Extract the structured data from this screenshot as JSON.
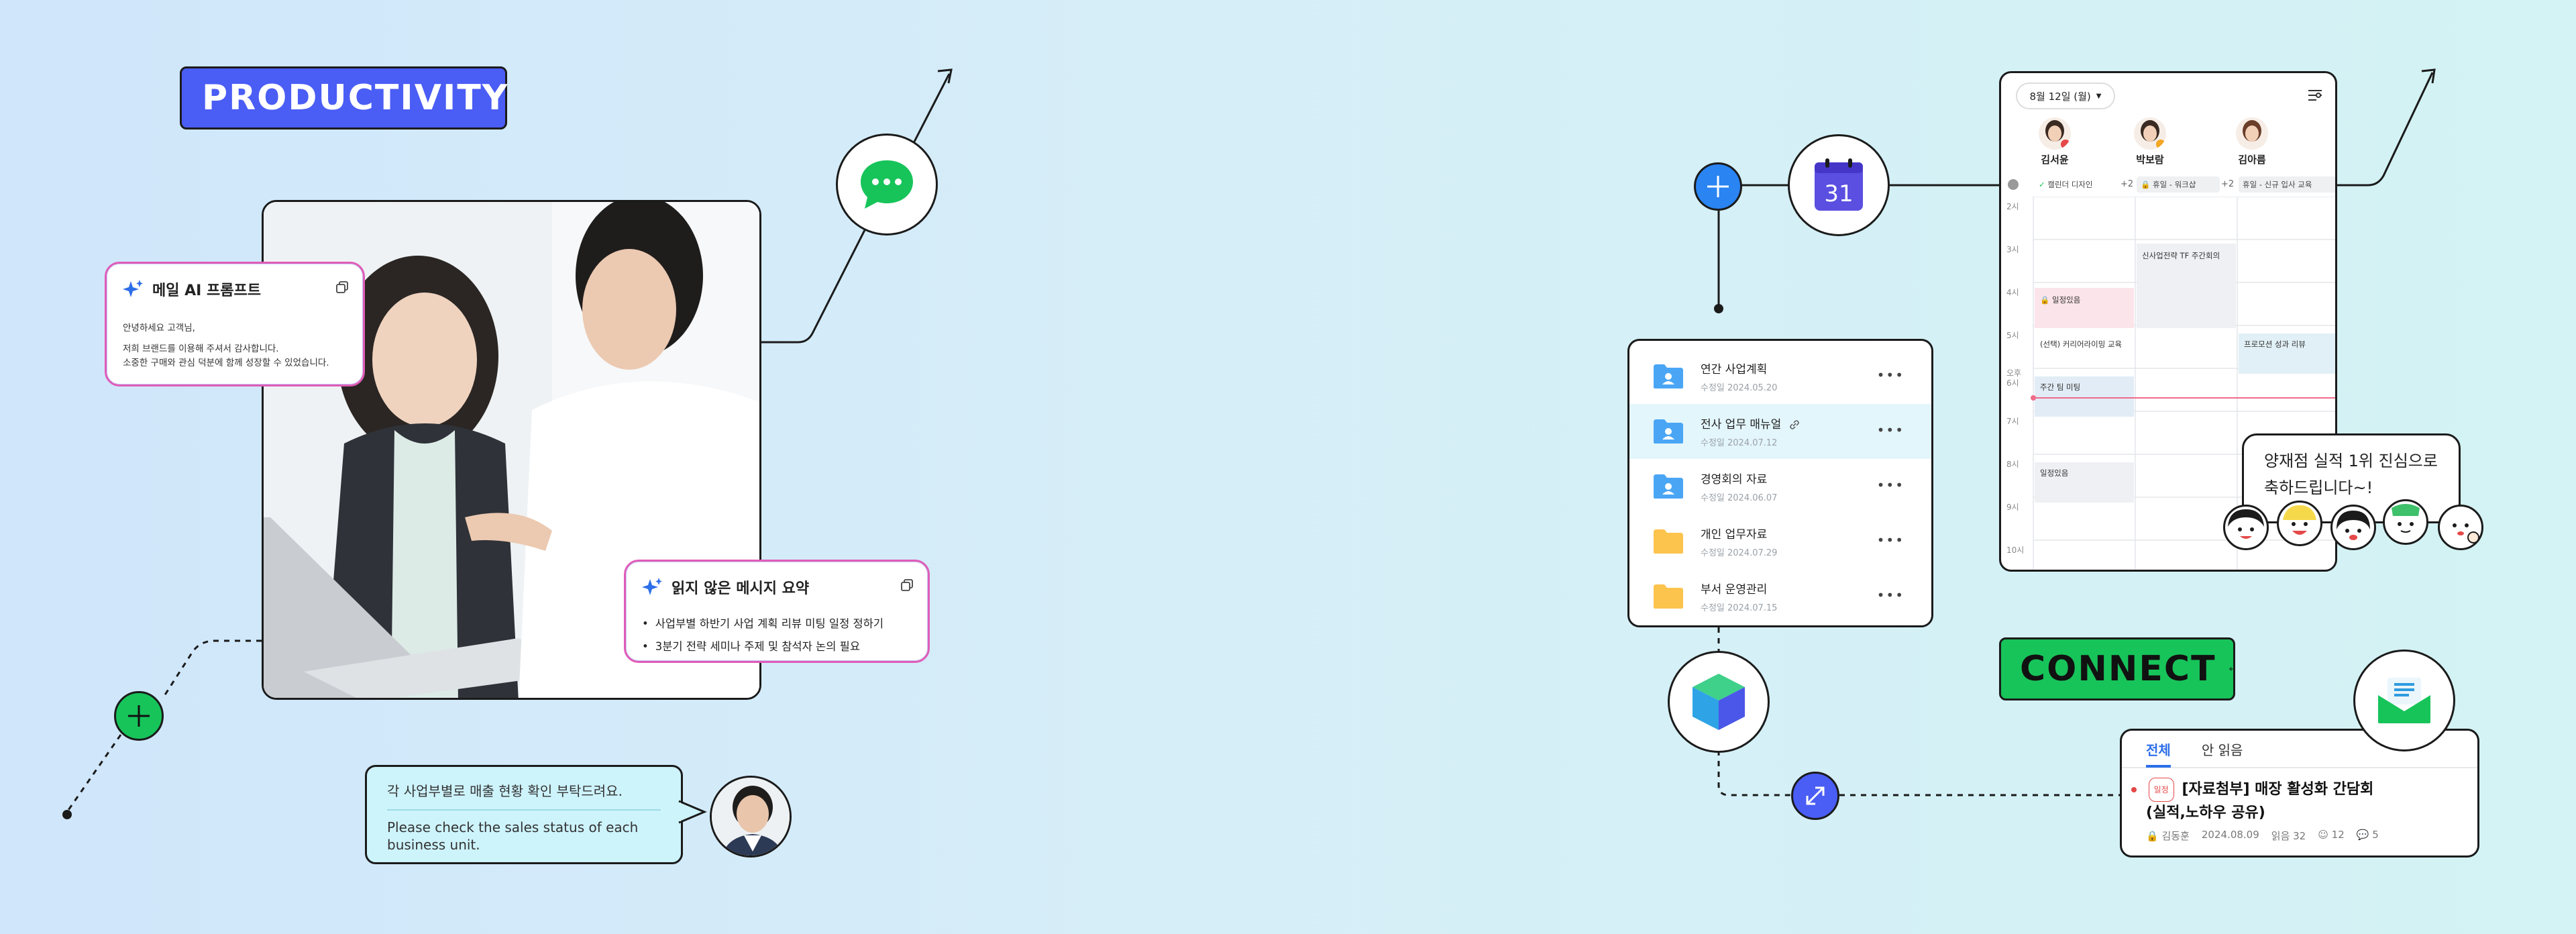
{
  "tags": {
    "productivity": "PRODUCTIVITY",
    "connect": "CONNECT"
  },
  "mail_ai_card": {
    "title": "메일 AI 프롬프트",
    "greeting": "안녕하세요 고객님,",
    "line1": "저희 브랜드를 이용해 주셔서 감사합니다.",
    "line2": "소중한 구매와 관심 덕분에 함께 성장할 수 있었습니다."
  },
  "unread_card": {
    "title": "읽지 않은 메시지 요약",
    "items": [
      "사업부별 하반기 사업 계획 리뷰 미팅 일정 정하기",
      "3분기 전략 세미나 주제 및 참석자 논의 필요"
    ]
  },
  "chat_bubble": {
    "korean": "각 사업부별로 매출 현황 확인 부탁드려요.",
    "english": "Please check the sales status of each business unit."
  },
  "calendar_icon": {
    "day": "31"
  },
  "files": [
    {
      "name": "연간 사업계획",
      "date": "수정일 2024.05.20",
      "icon": "shared-folder"
    },
    {
      "name": "전사 업무 매뉴얼",
      "date": "수정일 2024.07.12",
      "icon": "shared-folder"
    },
    {
      "name": "경영회의 자료",
      "date": "수정일 2024.06.07",
      "icon": "shared-folder"
    },
    {
      "name": "개인 업무자료",
      "date": "수정일 2024.07.29",
      "icon": "folder"
    },
    {
      "name": "부서 운영관리",
      "date": "수정일 2024.07.15",
      "icon": "folder"
    }
  ],
  "calendar": {
    "date_label": "8월 12일 (월)",
    "people": [
      "김서윤",
      "박보람",
      "김아름"
    ],
    "all_day": [
      "캘린더 디자인",
      "+2",
      "휴일 - 워크샵",
      "+2",
      "휴일 - 신규 입사 교육"
    ],
    "hours": [
      "2시",
      "3시",
      "4시",
      "5시",
      "오후 6시",
      "7시",
      "8시",
      "9시",
      "10시"
    ],
    "events": {
      "weekly_tf": "신사업전략 TF 주간회의",
      "schedule1": "일정있음",
      "career": "(선택) 커리어라이밍 교육",
      "promo": "프로모션 성과 리뷰",
      "team": "주간 팀 미팅",
      "schedule2": "일정있음"
    }
  },
  "congrats": {
    "line1": "양재점 실적 1위 진심으로",
    "line2": "축하드립니다~!"
  },
  "mail_list": {
    "tab_all": "전체",
    "tab_unread": "안 읽음",
    "badge": "일정",
    "subject_line1": "[자료첨부] 매장 활성화 간담회",
    "subject_line2": "(실적,노하우 공유)",
    "sender": "김동훈",
    "date": "2024.08.09",
    "reads": "읽음 32",
    "reactions": "12",
    "comments": "5"
  },
  "colors": {
    "productivity_bg": "#4a5df5",
    "connect_bg": "#17c45a",
    "accent_blue": "#2e6fe8",
    "ai_border": "#e05cb8"
  }
}
